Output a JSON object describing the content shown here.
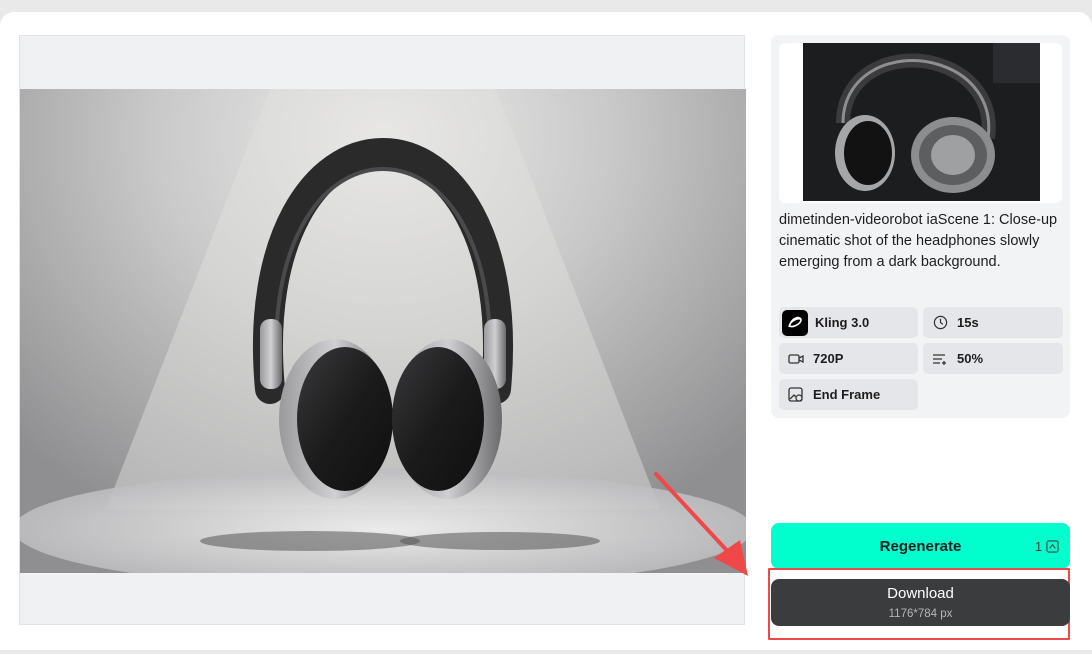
{
  "preview": {
    "image_name": "headphones-preview"
  },
  "info": {
    "thumbnail_name": "headphones-thumbnail",
    "prompt": "dimetinden-videorobot iaScene 1: Close-up cinematic shot of the headphones slowly emerging from a dark background.",
    "chips": {
      "model": "Kling 3.0",
      "duration": "15s",
      "resolution": "720P",
      "motion": "50%",
      "end_frame": "End Frame"
    }
  },
  "actions": {
    "regenerate_label": "Regenerate",
    "regenerate_cost": "1",
    "download_label": "Download",
    "download_size": "1176*784 px"
  },
  "colors": {
    "accent": "#00ffcc",
    "download_bg": "#3b3c3e",
    "highlight": "#f04848"
  },
  "icons": [
    "kling-logo-icon",
    "clock-icon",
    "camera-icon",
    "list-icon",
    "end-frame-icon",
    "credit-icon",
    "annotation-arrow-icon"
  ]
}
